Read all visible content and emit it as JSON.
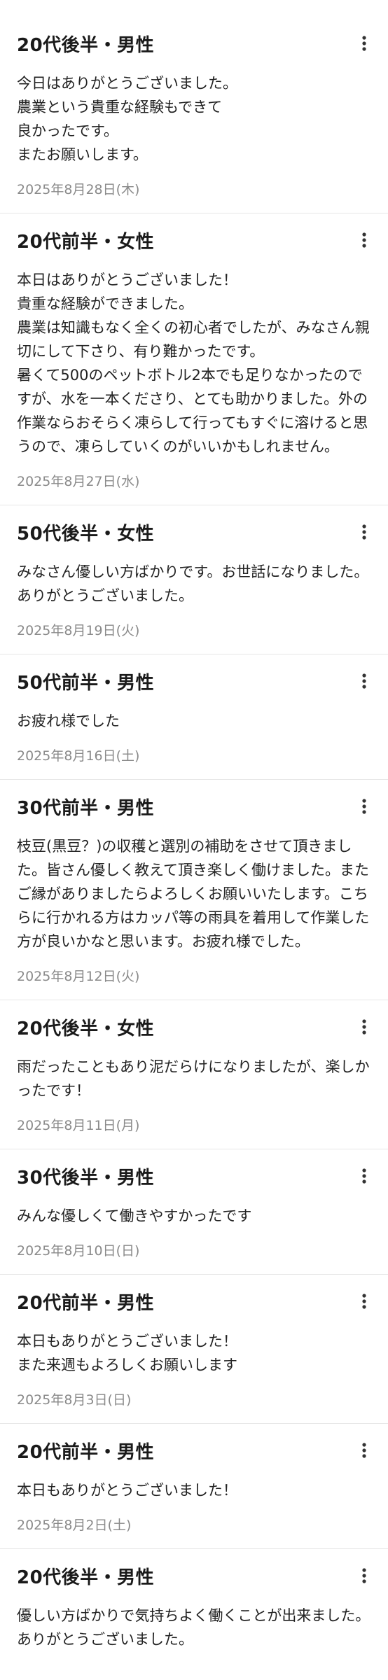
{
  "reviews": [
    {
      "title": "20代後半・男性",
      "body": "今日はありがとうございました。\n農業という貴重な経験もできて\n良かったです。\nまたお願いします。",
      "date": "2025年8月28日(木)"
    },
    {
      "title": "20代前半・女性",
      "body": "本日はありがとうございました！\n貴重な経験ができました。\n農業は知識もなく全くの初心者でしたが、みなさん親切にして下さり、有り難かったです。\n暑くて500のペットボトル2本でも足りなかったのですが、水を一本くださり、とても助かりました。外の作業ならおそらく凍らして行ってもすぐに溶けると思うので、凍らしていくのがいいかもしれません。",
      "date": "2025年8月27日(水)"
    },
    {
      "title": "50代後半・女性",
      "body": "みなさん優しい方ばかりです。お世話になりました。ありがとうございました。",
      "date": "2025年8月19日(火)"
    },
    {
      "title": "50代前半・男性",
      "body": "お疲れ様でした",
      "date": "2025年8月16日(土)"
    },
    {
      "title": "30代前半・男性",
      "body": "枝豆(黒豆？)の収穫と選別の補助をさせて頂きました。皆さん優しく教えて頂き楽しく働けました。またご縁がありましたらよろしくお願いいたします。こちらに行かれる方はカッパ等の雨具を着用して作業した方が良いかなと思います。お疲れ様でした。",
      "date": "2025年8月12日(火)"
    },
    {
      "title": "20代後半・女性",
      "body": "雨だったこともあり泥だらけになりましたが、楽しかったです！",
      "date": "2025年8月11日(月)"
    },
    {
      "title": "30代後半・男性",
      "body": "みんな優しくて働きやすかったです",
      "date": "2025年8月10日(日)"
    },
    {
      "title": "20代前半・男性",
      "body": "本日もありがとうございました！\nまた来週もよろしくお願いします",
      "date": "2025年8月3日(日)"
    },
    {
      "title": "20代前半・男性",
      "body": "本日もありがとうございました！\n",
      "date": "2025年8月2日(土)"
    },
    {
      "title": "20代後半・男性",
      "body": "優しい方ばかりで気持ちよく働くことが出来ました。\nありがとうございました。",
      "date": ""
    }
  ],
  "icons": {
    "more": "more-vert-icon"
  }
}
